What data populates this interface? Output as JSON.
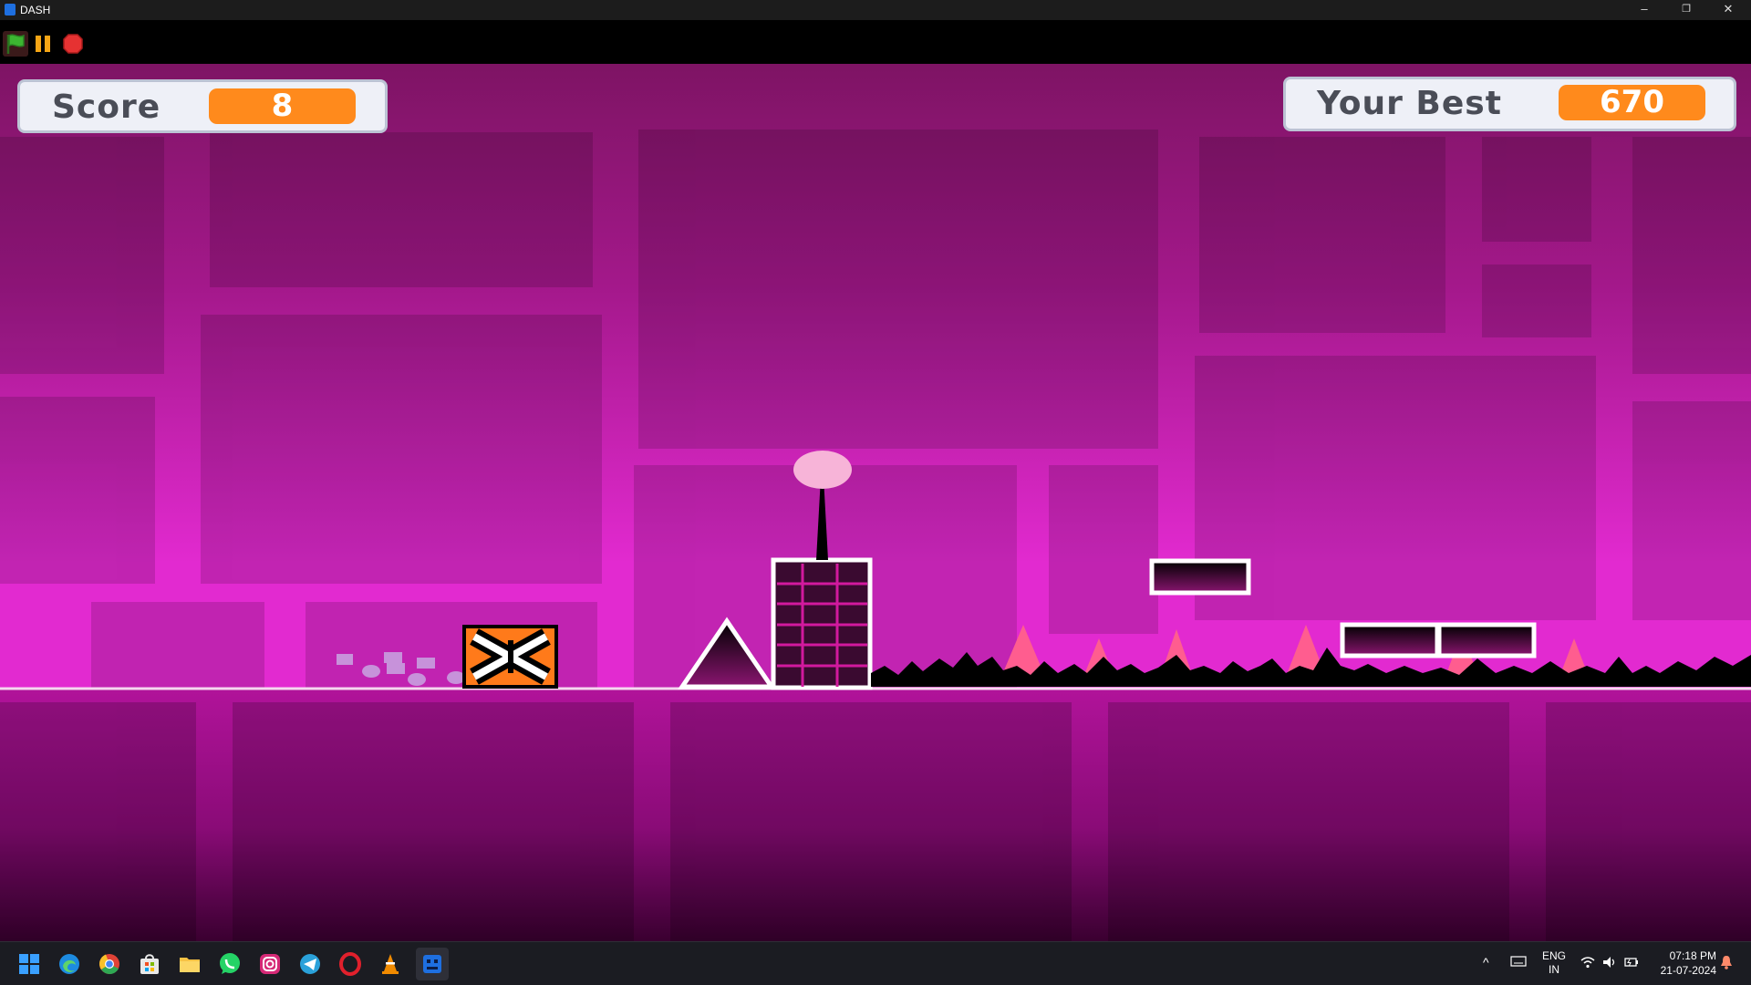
{
  "window": {
    "title": "DASH",
    "minimize": "–",
    "restore": "❐",
    "close": "✕"
  },
  "toolbar": {
    "icons": [
      "green-flag-icon",
      "pause-icon",
      "stop-icon"
    ]
  },
  "hud": {
    "score_label": "Score",
    "score_value": "8",
    "best_label": "Your Best",
    "best_value": "670"
  },
  "colors": {
    "accent": "#ff8a1c",
    "stage": "#c21fa0",
    "ground": "#a10e86"
  },
  "taskbar": {
    "apps": [
      "windows-start-icon",
      "edge-icon",
      "chrome-icon",
      "store-icon",
      "file-explorer-icon",
      "whatsapp-icon",
      "instagram-icon",
      "telegram-icon",
      "opera-icon",
      "vlc-icon",
      "dash-game-icon"
    ],
    "lang_top": "ENG",
    "lang_bottom": "IN",
    "time": "07:18 PM",
    "date": "21-07-2024"
  }
}
